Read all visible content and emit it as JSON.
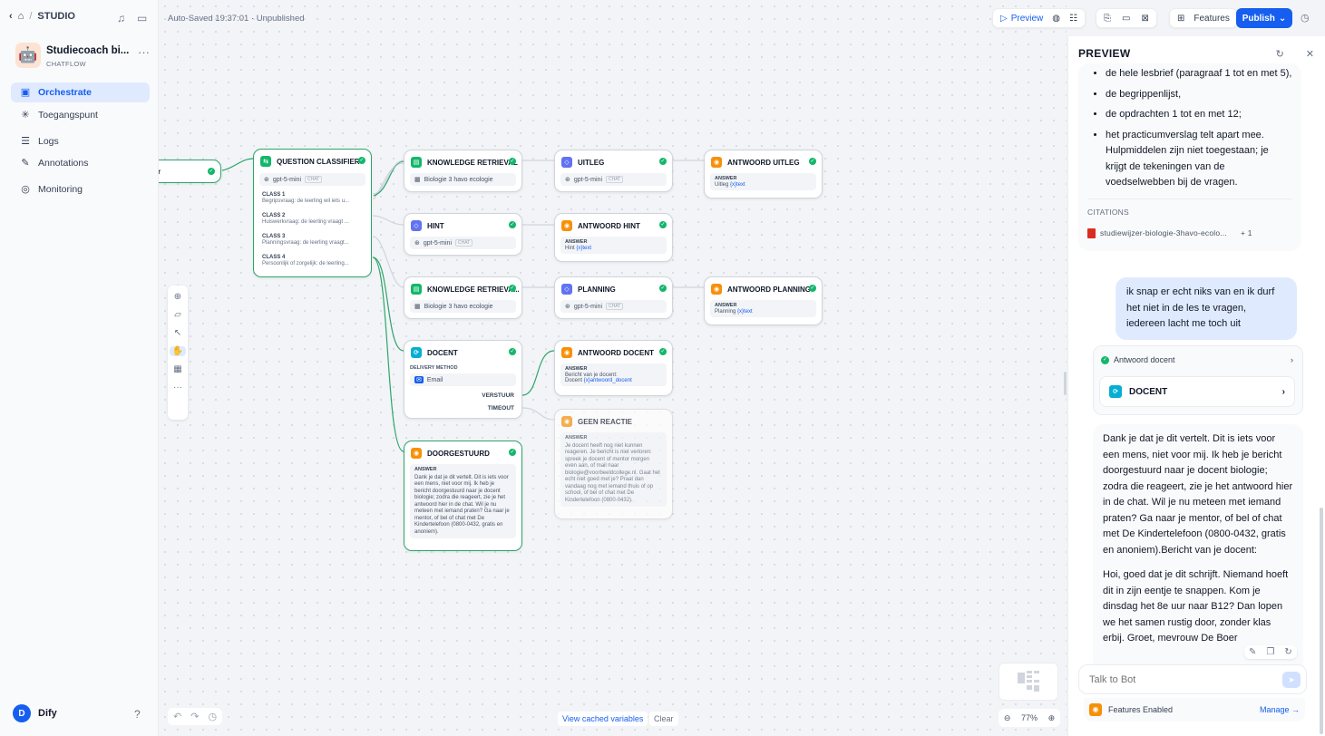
{
  "breadcrumb": {
    "section": "STUDIO"
  },
  "app": {
    "name": "Studiecoach bi...",
    "type": "CHATFLOW"
  },
  "nav": [
    {
      "label": "Orchestrate",
      "icon": "orchestrate-icon"
    },
    {
      "label": "Toegangspunt",
      "icon": "entry-icon"
    },
    {
      "label": "Logs",
      "icon": "logs-icon"
    },
    {
      "label": "Annotations",
      "icon": "annotations-icon"
    },
    {
      "label": "Monitoring",
      "icon": "monitoring-icon"
    }
  ],
  "user": {
    "initial": "D",
    "name": "Dify"
  },
  "header": {
    "autosave": "Auto-Saved 19:37:01 · Unpublished",
    "preview": "Preview",
    "features": "Features",
    "publish": "Publish"
  },
  "nodes": {
    "start_tail": "r",
    "qc": {
      "title": "QUESTION CLASSIFIER",
      "model": "gpt-5-mini",
      "tag": "CHAT",
      "classes": [
        {
          "name": "CLASS 1",
          "desc": "Begripsvraag: de leerling wil iets u..."
        },
        {
          "name": "CLASS 2",
          "desc": "Huiswerkvraag: de leerling vraagt ..."
        },
        {
          "name": "CLASS 3",
          "desc": "Planningsvraag: de leerling vraagt..."
        },
        {
          "name": "CLASS 4",
          "desc": "Persoonlijk of zorgelijk: de leerling..."
        }
      ]
    },
    "kr1": {
      "title": "KNOWLEDGE RETRIEVAL",
      "sub": "Biologie 3 havo ecologie"
    },
    "uitleg": {
      "title": "UITLEG",
      "model": "gpt-5-mini",
      "tag": "CHAT"
    },
    "a_uitleg": {
      "title": "ANTWOORD UITLEG",
      "label": "ANSWER",
      "var_node": "Uitleg",
      "var": "{x}text"
    },
    "hint": {
      "title": "HINT",
      "model": "gpt-5-mini",
      "tag": "CHAT"
    },
    "a_hint": {
      "title": "ANTWOORD HINT",
      "label": "ANSWER",
      "var_node": "Hint",
      "var": "{x}text"
    },
    "kr2": {
      "title": "KNOWLEDGE RETRIEVA...",
      "sub": "Biologie 3 havo ecologie"
    },
    "planning": {
      "title": "PLANNING",
      "model": "gpt-5-mini",
      "tag": "CHAT"
    },
    "a_planning": {
      "title": "ANTWOORD PLANNING",
      "label": "ANSWER",
      "var_node": "Planning",
      "var": "{x}text"
    },
    "docent": {
      "title": "DOCENT",
      "delivery_label": "DELIVERY METHOD",
      "method": "Email",
      "out1": "VERSTUUR",
      "out2": "TIMEOUT"
    },
    "a_docent": {
      "title": "ANTWOORD DOCENT",
      "label": "ANSWER",
      "text": "Bericht van je docent:",
      "var_node": "Docent",
      "var": "{x}antwoord_docent"
    },
    "geen": {
      "title": "GEEN REACTIE",
      "label": "ANSWER",
      "text": "Je docent heeft nog niet kunnen reageren. Je bericht is niet verloren: spreek je docent of mentor morgen even aan, of mail naar biologie@voorbeeldcollege.nl. Gaat het echt niet goed met je? Praat dan vandaag nog met iemand thuis of op school, of bel of chat met De Kindertelefoon (0800-0432)."
    },
    "doorgestuurd": {
      "title": "DOORGESTUURD",
      "label": "ANSWER",
      "text": "Dank je dat je dit vertelt. Dit is iets voor een mens, niet voor mij. Ik heb je bericht doorgestuurd naar je docent biologie; zodra die reageert, zie je het antwoord hier in de chat. Wil je nu meteen met iemand praten? Ga naar je mentor, of bel of chat met De Kindertelefoon (0800-0432, gratis en anoniem)."
    }
  },
  "canvas": {
    "cached": "View cached variables",
    "clear": "Clear",
    "zoom": "77%"
  },
  "preview": {
    "title": "PREVIEW",
    "bullets": [
      "de hele lesbrief (paragraaf 1 tot en met 5),",
      "de begrippenlijst,",
      "de opdrachten 1 tot en met 12;",
      "het practicumverslag telt apart mee. Hulpmiddelen zijn niet toegestaan; je krijgt de tekeningen van de voedselwebben bij de vragen."
    ],
    "citations_label": "CITATIONS",
    "citation_file": "studiewijzer-biologie-3havo-ecolo...",
    "citation_more": "+ 1",
    "user_msg": "ik snap er echt niks van en ik durf het niet in de les te vragen, iedereen lacht me toch uit",
    "workflow_step": "Antwoord docent",
    "workflow_node": "DOCENT",
    "answer_p1": "Dank je dat je dit vertelt. Dit is iets voor een mens, niet voor mij. Ik heb je bericht doorgestuurd naar je docent biologie; zodra die reageert, zie je het antwoord hier in de chat. Wil je nu meteen met iemand praten? Ga naar je mentor, of bel of chat met De Kindertelefoon (0800-0432, gratis en anoniem).Bericht van je docent:",
    "answer_p2": "Hoi, goed dat je dit schrijft. Niemand hoeft dit in zijn eentje te snappen. Kom je dinsdag het 8e uur naar B12? Dan lopen we het samen rustig door, zonder klas erbij. Groet, mevrouw De Boer",
    "input_placeholder": "Talk to Bot",
    "features_enabled": "Features Enabled",
    "manage": "Manage →"
  }
}
